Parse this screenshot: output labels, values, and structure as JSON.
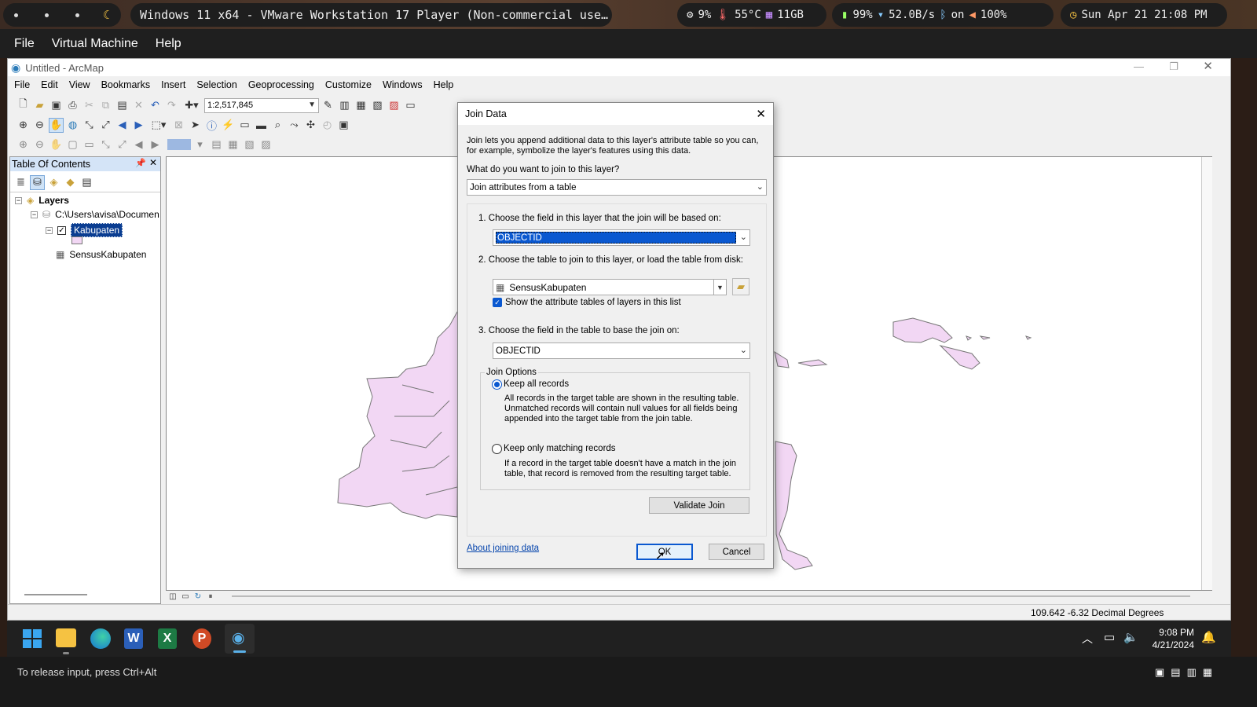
{
  "host": {
    "window_title": "Windows 11 x64 - VMware Workstation 17 Player (Non-commercial use…",
    "cpu": "9%",
    "temp": "55°C",
    "mem": "11GB",
    "battery": "99%",
    "net": "52.0B/s",
    "bt": "on",
    "volume": "100%",
    "datetime": "Sun Apr 21 21:08 PM"
  },
  "vm_menu": [
    "File",
    "Virtual Machine",
    "Help"
  ],
  "app": {
    "title": "Untitled - ArcMap",
    "menu": [
      "File",
      "Edit",
      "View",
      "Bookmarks",
      "Insert",
      "Selection",
      "Geoprocessing",
      "Customize",
      "Windows",
      "Help"
    ],
    "scale": "1:2,517,845"
  },
  "toc": {
    "title": "Table Of Contents",
    "layers": "Layers",
    "path": "C:\\Users\\avisa\\Documen",
    "layer": "Kabupaten",
    "table": "SensusKabupaten"
  },
  "dialog": {
    "title": "Join Data",
    "intro1": "Join lets you append additional data to this layer's attribute table so you can,",
    "intro2": "for example, symbolize the layer's features using this data.",
    "question": "What do you want to join to this layer?",
    "join_type": "Join attributes from a table",
    "step1": "1.  Choose the field in this layer that the join will be based on:",
    "field1": "OBJECTID",
    "step2": "2.  Choose the table to join to this layer, or load the table from disk:",
    "table": "SensusKabupaten",
    "show_layers": "Show the attribute tables of layers in this list",
    "step3": "3.  Choose the field in the table to base the join on:",
    "field2": "OBJECTID",
    "join_options": "Join Options",
    "keep_all": "Keep all records",
    "keep_all_desc1": "All records in the target table are shown in the resulting table.",
    "keep_all_desc2": "Unmatched records will contain null values for all fields being",
    "keep_all_desc3": "appended into the target table from the join table.",
    "keep_match": "Keep only matching records",
    "keep_match_desc1": "If a record in the target table doesn't have a match in the join",
    "keep_match_desc2": "table, that record is removed from the resulting target table.",
    "validate": "Validate Join",
    "about": "About joining data",
    "ok": "OK",
    "cancel": "Cancel"
  },
  "statusbar": {
    "coords": "109.642  -6.32 Decimal Degrees"
  },
  "tray": {
    "time": "9:08 PM",
    "date": "4/21/2024"
  },
  "vm_status": "To release input, press Ctrl+Alt"
}
